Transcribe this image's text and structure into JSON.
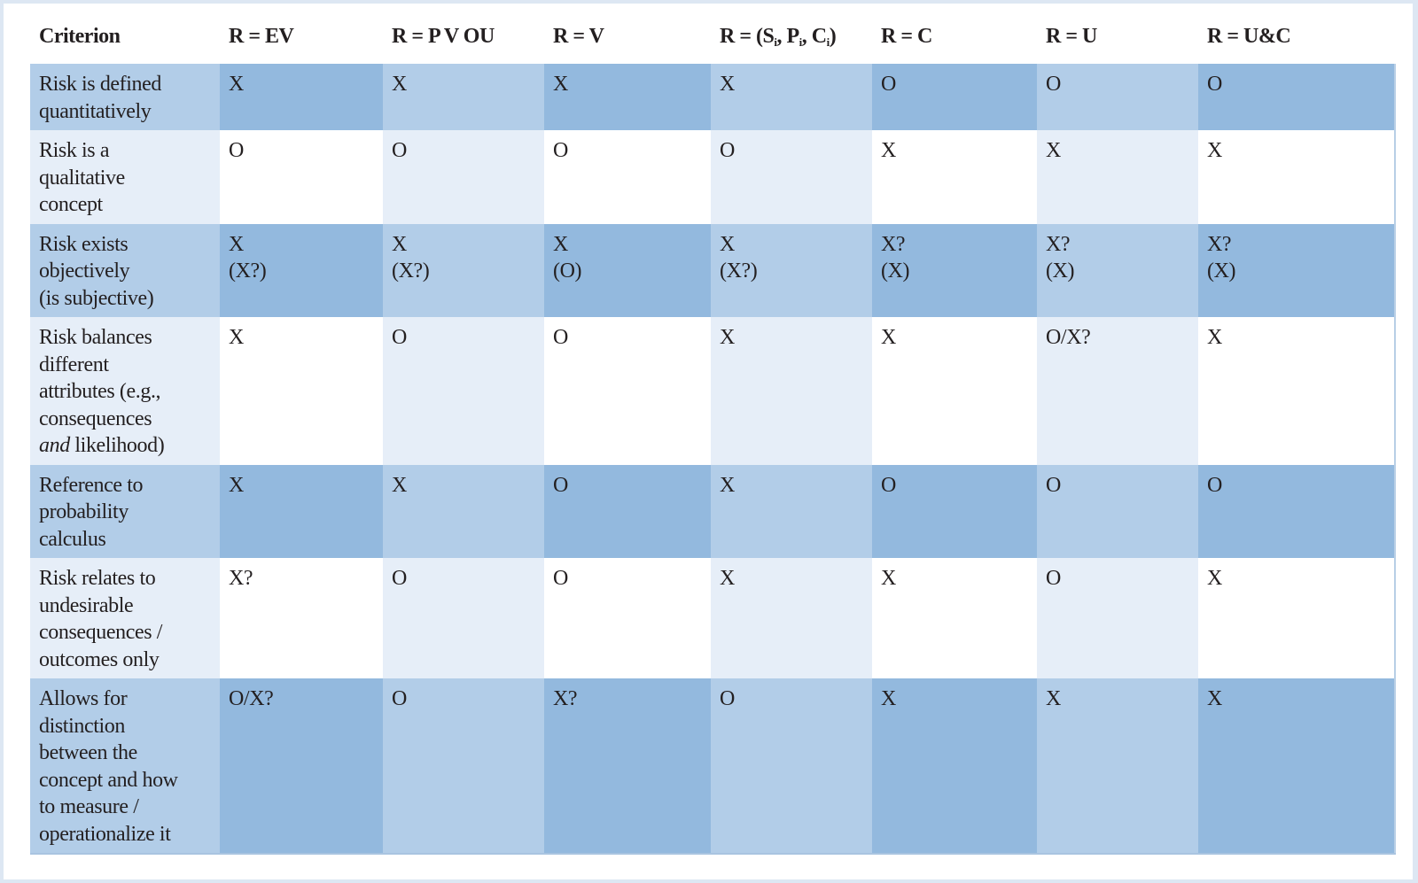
{
  "table": {
    "columns": [
      {
        "label": "Criterion"
      },
      {
        "label": "R = EV"
      },
      {
        "label": "R = P V OU"
      },
      {
        "label": "R = V"
      },
      {
        "label": "R = (S",
        "sub_parts": [
          "i",
          "P",
          "i",
          "C",
          "i"
        ],
        "full": "R = (Si, Pi, Ci)"
      },
      {
        "label": "R = C"
      },
      {
        "label": "R = U"
      },
      {
        "label": "R = U&C"
      }
    ],
    "rows": [
      {
        "criterion": [
          "Risk is defined",
          "quantitatively"
        ],
        "values": [
          [
            "X"
          ],
          [
            "X"
          ],
          [
            "X"
          ],
          [
            "X"
          ],
          [
            "O"
          ],
          [
            "O"
          ],
          [
            "O"
          ]
        ]
      },
      {
        "criterion": [
          "Risk is a",
          "qualitative",
          "concept"
        ],
        "values": [
          [
            "O"
          ],
          [
            "O"
          ],
          [
            "O"
          ],
          [
            "O"
          ],
          [
            "X"
          ],
          [
            "X"
          ],
          [
            "X"
          ]
        ]
      },
      {
        "criterion": [
          "Risk exists",
          "objectively",
          "(is subjective)"
        ],
        "values": [
          [
            "X",
            "(X?)"
          ],
          [
            "X",
            "(X?)"
          ],
          [
            "X",
            "(O)"
          ],
          [
            "X",
            "(X?)"
          ],
          [
            "X?",
            "(X)"
          ],
          [
            "X?",
            "(X)"
          ],
          [
            "X?",
            "(X)"
          ]
        ]
      },
      {
        "criterion": [
          "Risk balances",
          "different",
          "attributes (e.g.,",
          "consequences",
          "and likelihood)"
        ],
        "criterion_italic_word": "and",
        "values": [
          [
            "X"
          ],
          [
            "O"
          ],
          [
            "O"
          ],
          [
            "X"
          ],
          [
            "X"
          ],
          [
            "O/X?"
          ],
          [
            "X"
          ]
        ]
      },
      {
        "criterion": [
          "Reference to",
          "probability",
          "calculus"
        ],
        "values": [
          [
            "X"
          ],
          [
            "X"
          ],
          [
            "O"
          ],
          [
            "X"
          ],
          [
            "O"
          ],
          [
            "O"
          ],
          [
            "O"
          ]
        ]
      },
      {
        "criterion": [
          "Risk relates to",
          "undesirable",
          "consequences /",
          "outcomes only"
        ],
        "values": [
          [
            "X?"
          ],
          [
            "O"
          ],
          [
            "O"
          ],
          [
            "X"
          ],
          [
            "X"
          ],
          [
            "O"
          ],
          [
            "X"
          ]
        ]
      },
      {
        "criterion": [
          "Allows for",
          "distinction",
          "between the",
          "concept and how",
          "to measure /",
          "operationalize it"
        ],
        "values": [
          [
            "O/X?"
          ],
          [
            "O"
          ],
          [
            "X?"
          ],
          [
            "O"
          ],
          [
            "X"
          ],
          [
            "X"
          ],
          [
            "X"
          ]
        ]
      }
    ]
  },
  "colors": {
    "dark_odd": "#93b9de",
    "dark_even": "#b2cde8",
    "light_even": "#e6eef8",
    "light_odd": "#ffffff",
    "frame": "#dde7f3"
  }
}
